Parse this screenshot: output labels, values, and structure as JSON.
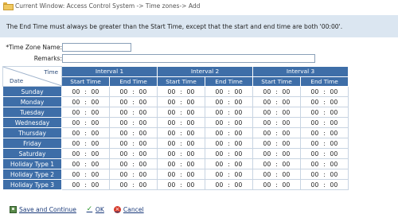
{
  "breadcrumb": "Current Window: Access Control System -> Time zones-> Add",
  "notice": "The End Time must always be greater than the Start Time, except that the start and end time are both '00:00'.",
  "form": {
    "name_label": "*Time Zone Name:",
    "name_value": "",
    "remarks_label": "Remarks:",
    "remarks_value": ""
  },
  "grid": {
    "corner_time": "Time",
    "corner_date": "Date",
    "intervals": [
      "Interval 1",
      "Interval 2",
      "Interval 3"
    ],
    "start_label": "Start Time",
    "end_label": "End Time",
    "time_hh": "00",
    "time_sep": ":",
    "time_mm": "00",
    "days": [
      "Sunday",
      "Monday",
      "Tuesday",
      "Wednesday",
      "Thursday",
      "Friday",
      "Saturday",
      "Holiday Type 1",
      "Holiday Type 2",
      "Holiday Type 3"
    ]
  },
  "actions": {
    "save_continue": "Save and Continue",
    "ok": "OK",
    "cancel": "Cancel"
  },
  "icons": {
    "breadcrumb": "folder-icon",
    "save": "save-icon",
    "ok": "checkmark-icon",
    "cancel": "cancel-icon"
  },
  "colors": {
    "header_blue": "#3e6ea8",
    "notice_bg": "#dbe6f1",
    "link": "#1a3a7a"
  }
}
